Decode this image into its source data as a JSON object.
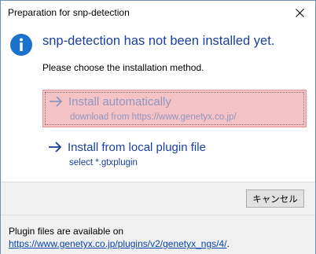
{
  "window": {
    "title": "Preparation for snp-detection"
  },
  "main": {
    "heading": "snp-detection has not been installed yet.",
    "instruction": "Please choose the installation method."
  },
  "options": {
    "auto": {
      "label": "Install automatically",
      "note": "download from https://www.genetyx.co.jp/"
    },
    "local": {
      "label": "Install from local plugin file",
      "note": "select *.gtxplugin"
    }
  },
  "buttons": {
    "cancel": "キャンセル"
  },
  "footer": {
    "prefix": "Plugin files are available on ",
    "link": "https://www.genetyx.co.jp/plugins/v2/genetyx_ngs/4/",
    "suffix": "."
  },
  "colors": {
    "heading": "#1a3f9c",
    "highlight_bg": "#f5c3c5",
    "highlight_border": "#e28f93",
    "info_icon": "#1a72cc"
  },
  "icons": {
    "info": "info-icon",
    "arrow": "arrow-right-icon",
    "close": "close-icon"
  }
}
